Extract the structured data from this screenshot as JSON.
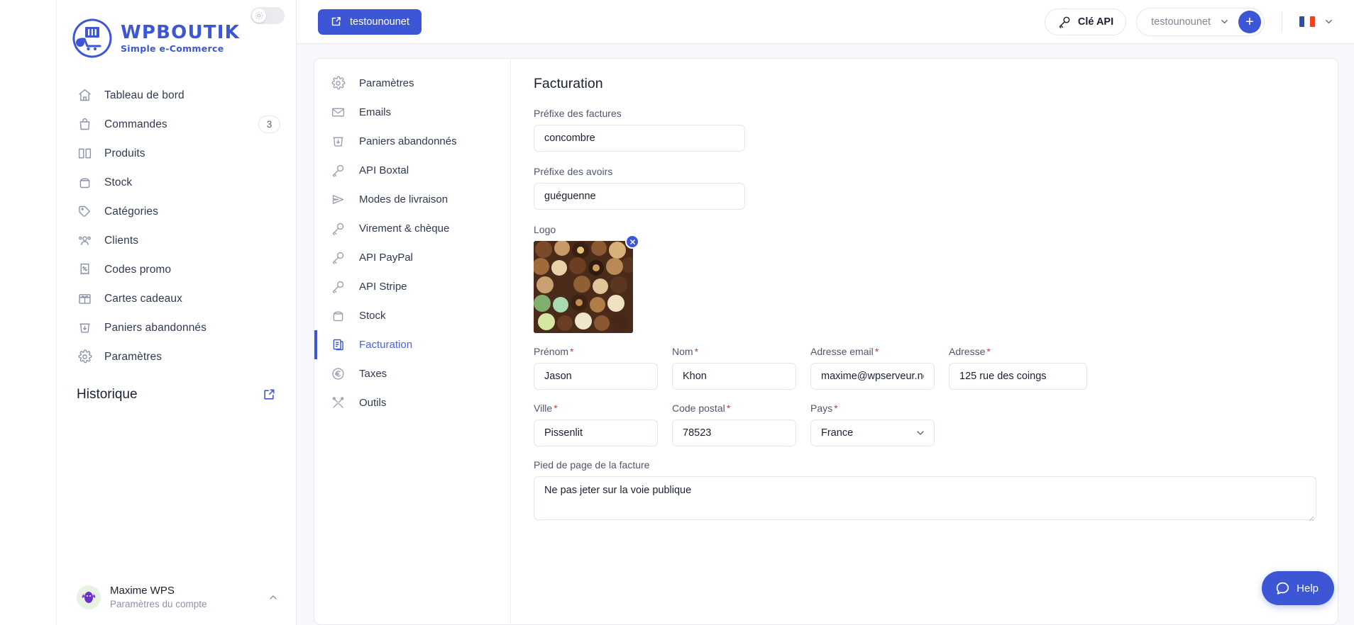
{
  "sidebar": {
    "theme_toggle": "sun-icon",
    "logo": {
      "title": "WPBOUTIK",
      "subtitle": "Simple e-Commerce"
    },
    "nav": [
      {
        "label": "Tableau de bord",
        "icon": "home-icon",
        "badge": null
      },
      {
        "label": "Commandes",
        "icon": "bag-icon",
        "badge": "3"
      },
      {
        "label": "Produits",
        "icon": "book-icon",
        "badge": null
      },
      {
        "label": "Stock",
        "icon": "box-icon",
        "badge": null
      },
      {
        "label": "Catégories",
        "icon": "tag-icon",
        "badge": null
      },
      {
        "label": "Clients",
        "icon": "users-icon",
        "badge": null
      },
      {
        "label": "Codes promo",
        "icon": "percent-receipt-icon",
        "badge": null
      },
      {
        "label": "Cartes cadeaux",
        "icon": "gift-icon",
        "badge": null
      },
      {
        "label": "Paniers abandonnés",
        "icon": "cart-down-icon",
        "badge": null
      },
      {
        "label": "Paramètres",
        "icon": "gear-icon",
        "badge": null
      }
    ],
    "historique": {
      "label": "Historique",
      "icon": "external-link-icon"
    },
    "account": {
      "name": "Maxime WPS",
      "subtitle": "Paramètres du compte",
      "chevron": "chevron-up-icon"
    }
  },
  "topbar": {
    "shop_button": {
      "label": "testounounet",
      "icon": "external-link-icon"
    },
    "api_button": {
      "label": "Clé API",
      "icon": "key-icon"
    },
    "account_select": {
      "value": "testounounet",
      "chevron": "chevron-down-icon"
    },
    "add_button": {
      "label": "+",
      "icon": "plus-icon"
    },
    "language": {
      "flag": "fr-flag-icon",
      "chevron": "chevron-down-icon"
    }
  },
  "subnav": {
    "items": [
      {
        "label": "Paramètres",
        "icon": "gear-icon",
        "active": false
      },
      {
        "label": "Emails",
        "icon": "envelope-icon",
        "active": false
      },
      {
        "label": "Paniers abandonnés",
        "icon": "cart-down-icon",
        "active": false
      },
      {
        "label": "API Boxtal",
        "icon": "key-icon",
        "active": false
      },
      {
        "label": "Modes de livraison",
        "icon": "send-icon",
        "active": false
      },
      {
        "label": "Virement & chèque",
        "icon": "key-icon",
        "active": false
      },
      {
        "label": "API PayPal",
        "icon": "key-icon",
        "active": false
      },
      {
        "label": "API Stripe",
        "icon": "key-icon",
        "active": false
      },
      {
        "label": "Stock",
        "icon": "box-icon",
        "active": false
      },
      {
        "label": "Facturation",
        "icon": "clipboard-icon",
        "active": true
      },
      {
        "label": "Taxes",
        "icon": "euro-icon",
        "active": false
      },
      {
        "label": "Outils",
        "icon": "tools-icon",
        "active": false
      }
    ]
  },
  "form": {
    "title": "Facturation",
    "invoice_prefix": {
      "label": "Préfixe des factures",
      "value": "concombre"
    },
    "credit_prefix": {
      "label": "Préfixe des avoirs",
      "value": "guéguenne"
    },
    "logo": {
      "label": "Logo",
      "remove_icon": "close-icon",
      "alt": "chocolats"
    },
    "firstname": {
      "label": "Prénom",
      "required": "*",
      "value": "Jason"
    },
    "lastname": {
      "label": "Nom",
      "required": "*",
      "value": "Khon"
    },
    "email": {
      "label": "Adresse email",
      "required": "*",
      "value": "maxime@wpserveur.net"
    },
    "address": {
      "label": "Adresse",
      "required": "*",
      "value": "125 rue des coings"
    },
    "city": {
      "label": "Ville",
      "required": "*",
      "value": "Pissenlit"
    },
    "zip": {
      "label": "Code postal",
      "required": "*",
      "value": "78523"
    },
    "country": {
      "label": "Pays",
      "required": "*",
      "value": "France",
      "chevron": "chevron-down-icon"
    },
    "footer": {
      "label": "Pied de page de la facture",
      "value": "Ne pas jeter sur la voie publique"
    }
  },
  "help": {
    "label": "Help",
    "icon": "chat-icon"
  },
  "colors": {
    "accent": "#3c56d6",
    "required": "#e0342b",
    "text": "#19202e",
    "muted": "#8b93a5"
  }
}
